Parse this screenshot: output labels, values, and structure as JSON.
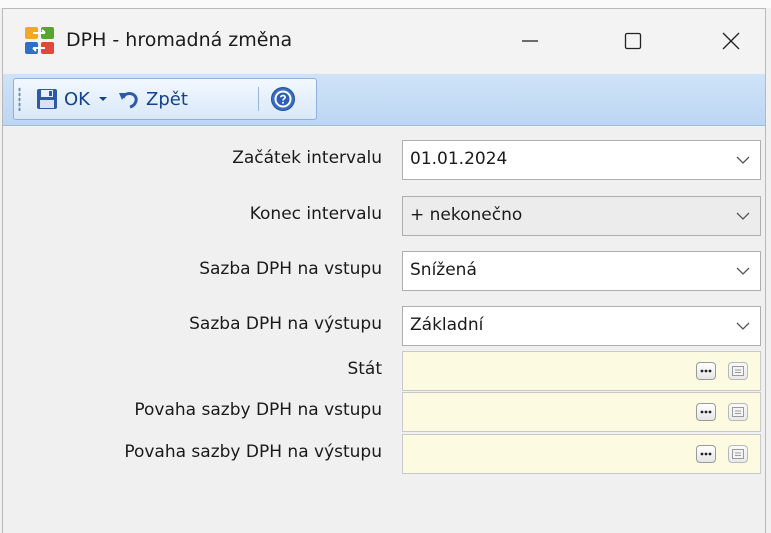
{
  "window": {
    "title": "DPH - hromadná změna",
    "icon": "app-grid-icon",
    "controls": [
      "minimize-icon",
      "maximize-icon",
      "close-icon"
    ]
  },
  "toolbar": {
    "ok_label": "OK",
    "back_label": "Zpět",
    "icons": [
      "save-icon",
      "dropdown-arrow-icon",
      "undo-icon",
      "help-icon"
    ]
  },
  "form": {
    "fields": [
      {
        "label": "Začátek intervalu",
        "value": "01.01.2024",
        "kind": "combo"
      },
      {
        "label": "Konec intervalu",
        "value": "+ nekonečno",
        "kind": "combo-disabled"
      },
      {
        "label": "Sazba DPH na vstupu",
        "value": "Snížená",
        "kind": "combo"
      },
      {
        "label": "Sazba DPH na výstupu",
        "value": "Základní",
        "kind": "combo"
      },
      {
        "label": "Stát",
        "value": "",
        "kind": "lookup"
      },
      {
        "label": "Povaha sazby DPH na vstupu",
        "value": "",
        "kind": "lookup"
      },
      {
        "label": "Povaha sazby DPH na výstupu",
        "value": "",
        "kind": "lookup"
      }
    ]
  },
  "colors": {
    "toolbar_bg": "#c6dcf5",
    "lookup_bg": "#fcfbe1",
    "disabled_bg": "#ececec",
    "toolbar_text": "#15428b"
  }
}
